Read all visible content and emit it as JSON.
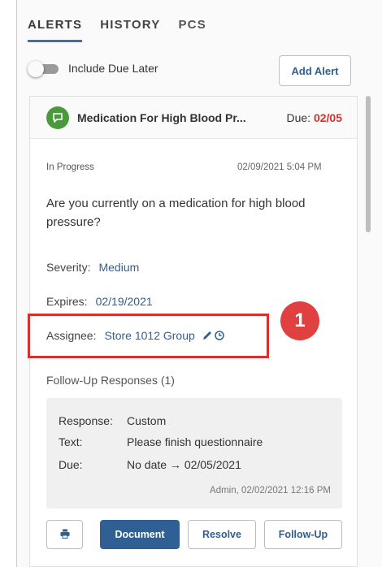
{
  "tabs": [
    {
      "label": "ALERTS",
      "active": true
    },
    {
      "label": "HISTORY",
      "active": false
    },
    {
      "label": "PCS",
      "active": false
    }
  ],
  "toolbar": {
    "include_due_later_label": "Include Due Later",
    "include_due_later_on": false,
    "add_alert_label": "Add Alert"
  },
  "alert": {
    "icon": "chat-bubble-icon",
    "title": "Medication For High Blood Pr...",
    "due_label": "Due:",
    "due_date": "02/05",
    "status": "In Progress",
    "timestamp": "02/09/2021 5:04 PM",
    "question": "Are you currently on a medication for high blood pressure?",
    "severity_label": "Severity:",
    "severity_value": "Medium",
    "expires_label": "Expires:",
    "expires_value": "02/19/2021",
    "assignee_label": "Assignee:",
    "assignee_value": "Store 1012 Group"
  },
  "callout": {
    "number": "1"
  },
  "followup": {
    "heading": "Follow-Up Responses (1)",
    "response_label": "Response:",
    "response_value": "Custom",
    "text_label": "Text:",
    "text_value": "Please finish questionnaire",
    "due_label": "Due:",
    "due_value": "No date → 02/05/2021",
    "meta": "Admin, 02/02/2021 12:16 PM"
  },
  "actions": {
    "document_label": "Document",
    "resolve_label": "Resolve",
    "followup_label": "Follow-Up"
  },
  "colors": {
    "accent": "#2f5f93",
    "due_red": "#d9302c",
    "callout_red": "#e04040",
    "alert_icon_green": "#4a9a3c"
  }
}
